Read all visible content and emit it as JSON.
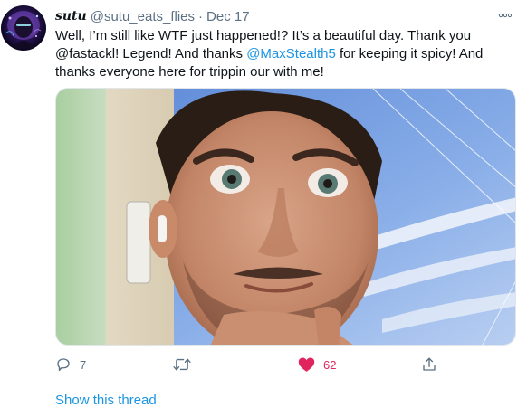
{
  "tweet": {
    "display_name": "sutu",
    "handle": "@sutu_eats_flies",
    "separator": "·",
    "date": "Dec 17",
    "text": {
      "part1": "Well, I’m still like WTF just happened!? It’s a beautiful day. Thank you @fastackl! Legend! And thanks  ",
      "mention": "@MaxStealth5",
      "part2": " for keeping it spicy! And thanks everyone here for trippin our with me!"
    },
    "more_icon": "more-horizontal-icon",
    "media_description_icon": "photo"
  },
  "actions": {
    "reply": {
      "icon": "reply-icon",
      "count": "7"
    },
    "retweet": {
      "icon": "retweet-icon",
      "count": ""
    },
    "like": {
      "icon": "heart-filled-icon",
      "count": "62",
      "color": "#e0245e"
    },
    "share": {
      "icon": "share-icon"
    }
  },
  "footer": {
    "show_thread": "Show this thread"
  },
  "colors": {
    "link": "#1b95e0",
    "secondary_text": "#5b7083",
    "like": "#e0245e"
  }
}
